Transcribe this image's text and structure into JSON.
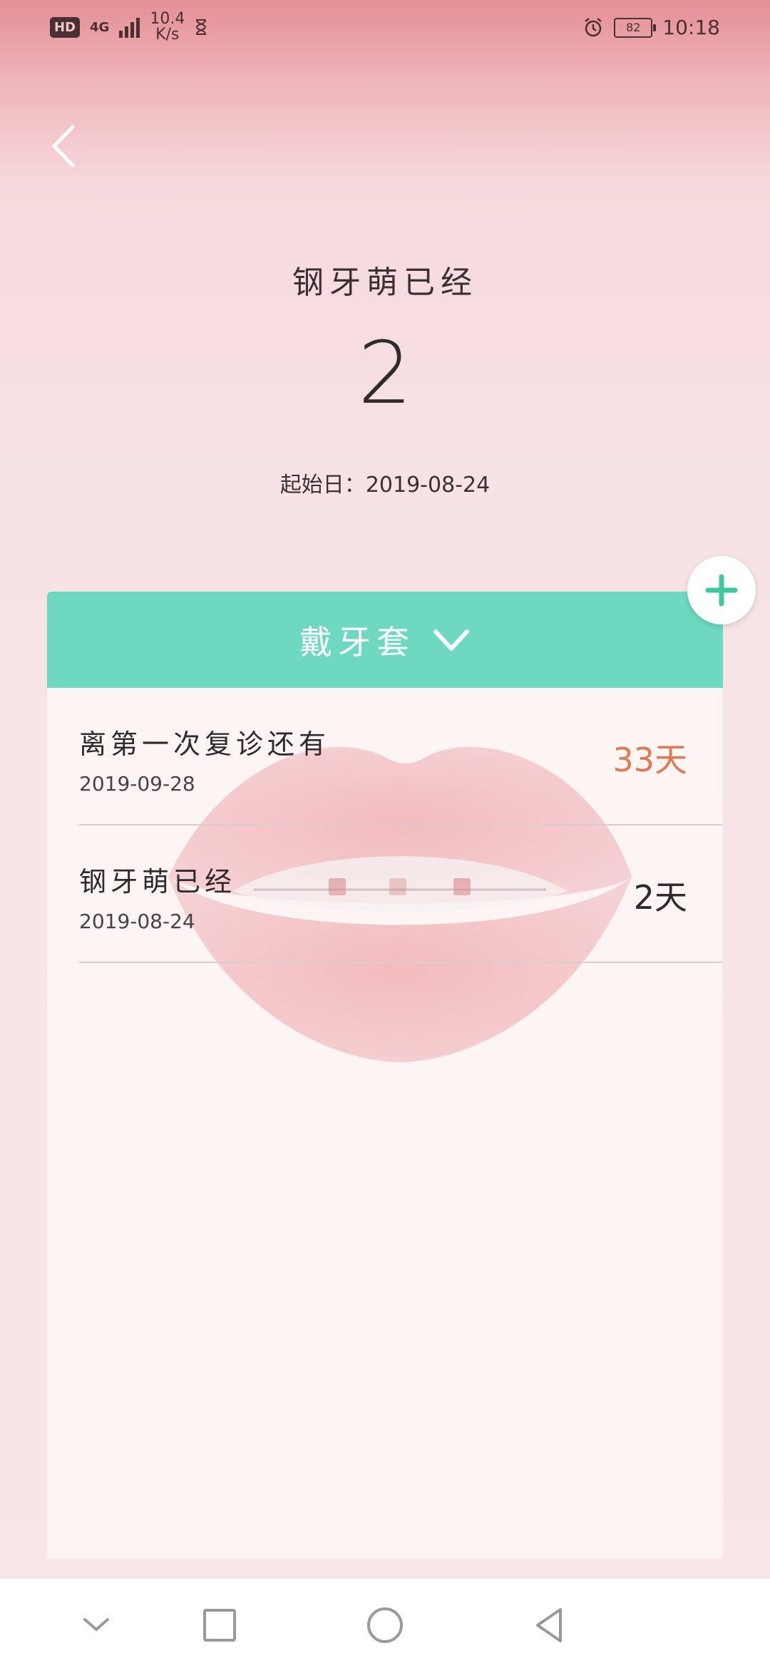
{
  "status_bar": {
    "hd": "HD",
    "network": "4G",
    "speed_value": "10.4",
    "speed_unit": "K/s",
    "battery": "82",
    "time": "10:18"
  },
  "header": {
    "title": "钢牙萌已经",
    "count": "2",
    "start_label": "起始日：",
    "start_date": "2019-08-24"
  },
  "card": {
    "title": "戴牙套",
    "items": [
      {
        "title": "离第一次复诊还有",
        "date": "2019-09-28",
        "days": "33天",
        "highlight": true
      },
      {
        "title": "钢牙萌已经",
        "date": "2019-08-24",
        "days": "2天",
        "highlight": false
      }
    ]
  },
  "colors": {
    "accent": "#6ed8c0",
    "highlight_text": "#e07a52"
  },
  "icons": [
    "back-icon",
    "chevron-down-icon",
    "plus-icon",
    "alarm-icon",
    "hourglass-icon"
  ],
  "nav": [
    "collapse-icon",
    "recents-icon",
    "home-icon",
    "back-nav-icon"
  ]
}
